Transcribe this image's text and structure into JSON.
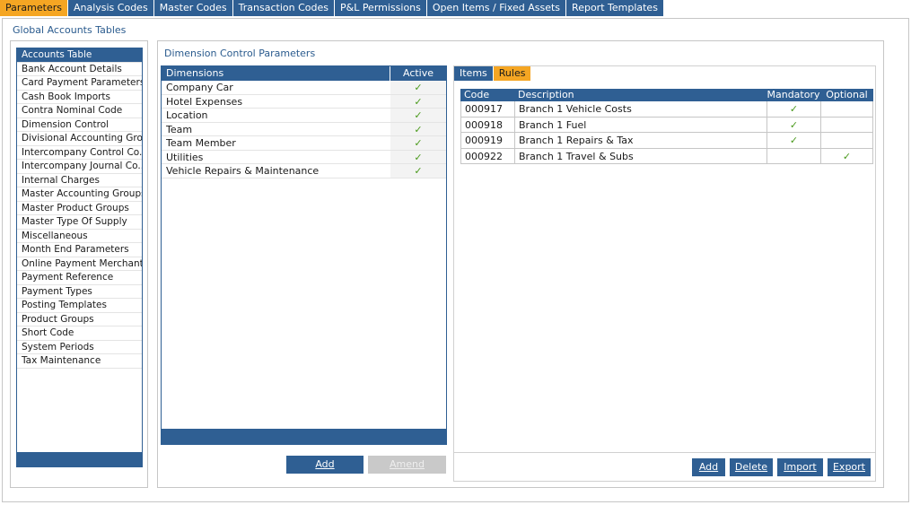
{
  "top_tabs": [
    {
      "label": "Parameters"
    },
    {
      "label": "Analysis Codes"
    },
    {
      "label": "Master Codes"
    },
    {
      "label": "Transaction Codes"
    },
    {
      "label": "P&L Permissions"
    },
    {
      "label": "Open Items / Fixed Assets"
    },
    {
      "label": "Report Templates"
    }
  ],
  "global_title": "Global Accounts Tables",
  "left_items": [
    "Accounts Table",
    "Bank Account Details",
    "Card Payment Parameters",
    "Cash Book Imports",
    "Contra Nominal Code",
    "Dimension Control",
    "Divisional Accounting Gro...",
    "Intercompany Control Co...",
    "Intercompany Journal Co...",
    "Internal Charges",
    "Master Accounting Groups",
    "Master Product Groups",
    "Master Type Of Supply",
    "Miscellaneous",
    "Month End Parameters",
    "Online Payment Merchants",
    "Payment Reference",
    "Payment Types",
    "Posting Templates",
    "Product Groups",
    "Short Code",
    "System Periods",
    "Tax Maintenance"
  ],
  "dimension_panel": {
    "title": "Dimension Control Parameters",
    "col_dimensions": "Dimensions",
    "col_active": "Active",
    "rows": [
      {
        "name": "Company Car",
        "active": "✓"
      },
      {
        "name": "Hotel Expenses",
        "active": "✓"
      },
      {
        "name": "Location",
        "active": "✓"
      },
      {
        "name": "Team",
        "active": "✓"
      },
      {
        "name": "Team Member",
        "active": "✓"
      },
      {
        "name": "Utilities",
        "active": "✓"
      },
      {
        "name": "Vehicle Repairs & Maintenance",
        "active": "✓"
      }
    ],
    "add_label": "Add",
    "amend_label": "Amend"
  },
  "rules_panel": {
    "tabs": [
      "Items",
      "Rules"
    ],
    "columns": {
      "code": "Code",
      "description": "Description",
      "mandatory": "Mandatory",
      "optional": "Optional"
    },
    "rows": [
      {
        "code": "000917",
        "description": "Branch 1 Vehicle Costs",
        "mandatory": "✓",
        "optional": ""
      },
      {
        "code": "000918",
        "description": "Branch 1 Fuel",
        "mandatory": "✓",
        "optional": ""
      },
      {
        "code": "000919",
        "description": "Branch 1 Repairs & Tax",
        "mandatory": "✓",
        "optional": ""
      },
      {
        "code": "000922",
        "description": "Branch 1 Travel & Subs",
        "mandatory": "",
        "optional": "✓"
      }
    ],
    "buttons": {
      "add": "Add",
      "delete": "Delete",
      "import": "Import",
      "export": "Export"
    }
  }
}
